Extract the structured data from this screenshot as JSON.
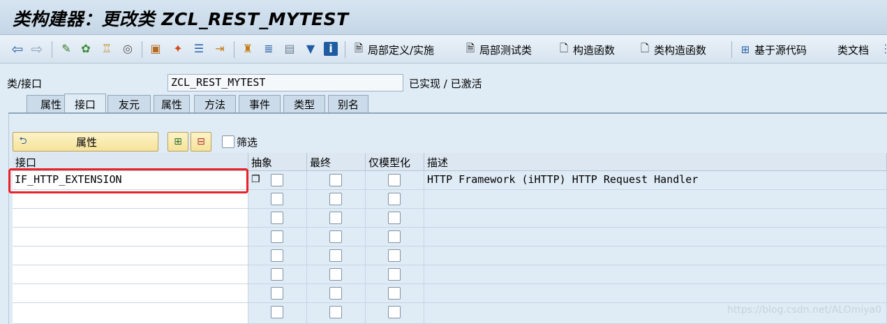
{
  "window": {
    "title": "类构建器：更改类 ZCL_REST_MYTEST"
  },
  "toolbar": {
    "icons": [
      "back-arrow-icon",
      "forward-arrow-icon",
      "other-object-icon",
      "display-change-icon",
      "activate-icon",
      "where-used-icon",
      "object-list-icon",
      "pretty-printer-icon",
      "hierarchy-icon",
      "magic-wand-icon",
      "navigation-icon",
      "redirect-icon",
      "tree-icon",
      "text-align-icon",
      "layout-icon",
      "filter-icon",
      "info-icon"
    ],
    "buttons": [
      {
        "label": "局部定义/实施",
        "icon": "document-icon"
      },
      {
        "label": "局部测试类",
        "icon": "document-icon"
      },
      {
        "label": "构造函数",
        "icon": "blank-page-icon"
      },
      {
        "label": "类构造函数",
        "icon": "blank-page-icon"
      },
      {
        "label": "基于源代码",
        "icon": "source-code-icon"
      },
      {
        "label": "类文档",
        "icon": ""
      }
    ]
  },
  "header": {
    "class_label": "类/接口",
    "class_value": "ZCL_REST_MYTEST",
    "status": "已实现 / 已激活"
  },
  "tabs": [
    {
      "label": "属性",
      "active": false
    },
    {
      "label": "接口",
      "active": true
    },
    {
      "label": "友元",
      "active": false
    },
    {
      "label": "属性",
      "active": false
    },
    {
      "label": "方法",
      "active": false
    },
    {
      "label": "事件",
      "active": false
    },
    {
      "label": "类型",
      "active": false
    },
    {
      "label": "别名",
      "active": false
    }
  ],
  "actions": {
    "attributes_button": "属性",
    "filter_label": "筛选"
  },
  "grid": {
    "columns": [
      "接口",
      "抽象",
      "最终",
      "仅模型化",
      "描述"
    ],
    "rows": [
      {
        "interface": "IF_HTTP_EXTENSION",
        "abstract": false,
        "final": false,
        "model_only": false,
        "description": "HTTP Framework (iHTTP) HTTP Request Handler"
      },
      {
        "interface": "",
        "abstract": false,
        "final": false,
        "model_only": false,
        "description": ""
      },
      {
        "interface": "",
        "abstract": false,
        "final": false,
        "model_only": false,
        "description": ""
      },
      {
        "interface": "",
        "abstract": false,
        "final": false,
        "model_only": false,
        "description": ""
      },
      {
        "interface": "",
        "abstract": false,
        "final": false,
        "model_only": false,
        "description": ""
      },
      {
        "interface": "",
        "abstract": false,
        "final": false,
        "model_only": false,
        "description": ""
      },
      {
        "interface": "",
        "abstract": false,
        "final": false,
        "model_only": false,
        "description": ""
      },
      {
        "interface": "",
        "abstract": false,
        "final": false,
        "model_only": false,
        "description": ""
      }
    ]
  },
  "watermark": "https://blog.csdn.net/ALOmiya0",
  "colors": {
    "highlight": "#e8212a",
    "background": "#dfebf5"
  }
}
